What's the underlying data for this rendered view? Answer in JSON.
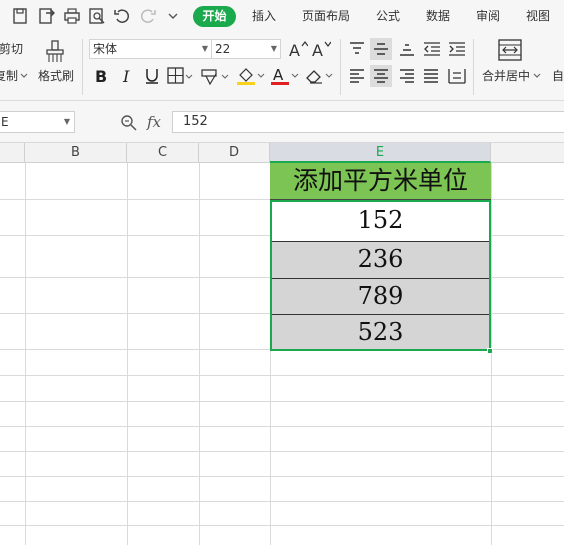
{
  "menubar": {
    "tabs": [
      "开始",
      "插入",
      "页面布局",
      "公式",
      "数据",
      "审阅",
      "视图"
    ]
  },
  "ribbon": {
    "cut_label": "剪切",
    "copy_label": "复制",
    "format_painter_label": "格式刷",
    "font_name": "宋体",
    "font_size": "22",
    "merge_center_label": "合并居中",
    "auto_wrap_label": "自",
    "colors": {
      "font_color_bar": "#e02020",
      "fill_color_bar": "#f7d21c"
    }
  },
  "formula_bar": {
    "name_box": "E",
    "fx_label": "fx",
    "formula_value": "152"
  },
  "columns": [
    "B",
    "C",
    "D",
    "E"
  ],
  "sheet": {
    "header_cell": "添加平方米单位",
    "values": [
      "152",
      "236",
      "789",
      "523"
    ]
  },
  "theme": {
    "accent": "#1aa94c",
    "header_fill": "#7cc453",
    "grey_fill": "#d5d5d5"
  }
}
